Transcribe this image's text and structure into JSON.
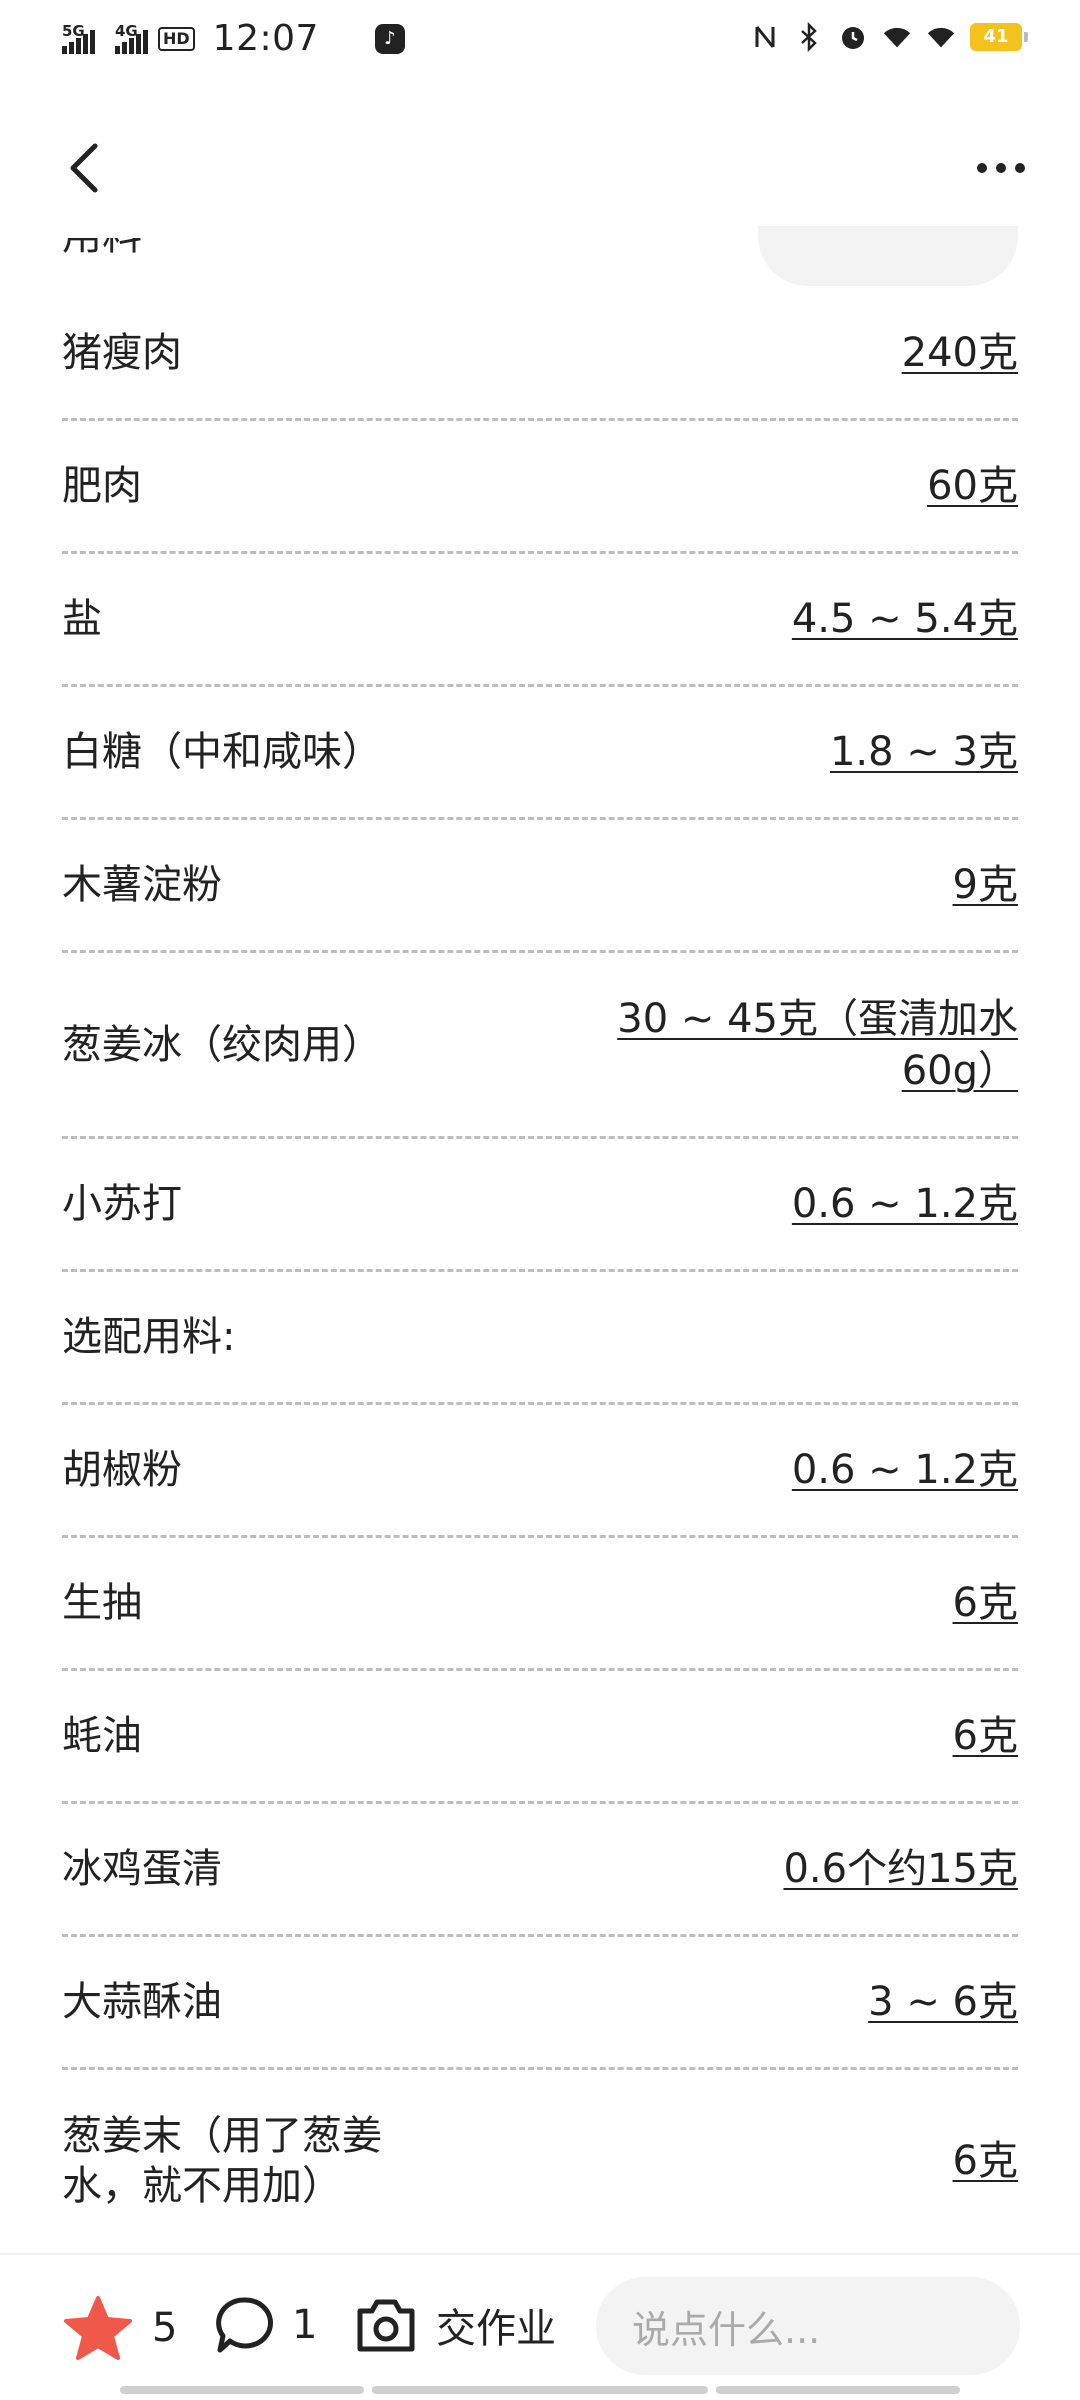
{
  "status_bar": {
    "signal_1_label": "5G",
    "signal_2_label": "4G",
    "hd_label": "HD",
    "time": "12:07",
    "battery": "41"
  },
  "icons": {
    "back": "chevron-left-icon",
    "more": "more-dots-icon",
    "favorite": "star-icon",
    "comment": "comment-bubble-icon",
    "camera": "camera-icon"
  },
  "colors": {
    "star": "#f0584a",
    "battery": "#f4c21c",
    "divider": "#bdbdbd"
  },
  "ingredients": [
    {
      "name": "猪瘦肉",
      "amount": "240克"
    },
    {
      "name": "肥肉",
      "amount": "60克"
    },
    {
      "name": "盐",
      "amount": "4.5 ~ 5.4克"
    },
    {
      "name": "白糖（中和咸味）",
      "amount": "1.8 ~ 3克"
    },
    {
      "name": "木薯淀粉",
      "amount": "9克"
    },
    {
      "name": "葱姜冰（绞肉用）",
      "amount_line1": "30 ~ 45克（蛋清加水",
      "amount_line2": "60g）"
    },
    {
      "name": "小苏打",
      "amount": "0.6 ~ 1.2克"
    },
    {
      "name": "选配用料:",
      "amount": ""
    },
    {
      "name": "胡椒粉",
      "amount": "0.6 ~ 1.2克"
    },
    {
      "name": "生抽",
      "amount": "6克"
    },
    {
      "name": "蚝油",
      "amount": "6克"
    },
    {
      "name": "冰鸡蛋清",
      "amount": "0.6个约15克"
    },
    {
      "name": "大蒜酥油",
      "amount": "3 ~ 6克"
    },
    {
      "name_line1": "葱姜末（用了葱姜",
      "name_line2": "水，就不用加）",
      "amount": "6克"
    }
  ],
  "bottom_bar": {
    "favorite_count": "5",
    "comment_count": "1",
    "homework_label": "交作业",
    "comment_placeholder": "说点什么..."
  }
}
